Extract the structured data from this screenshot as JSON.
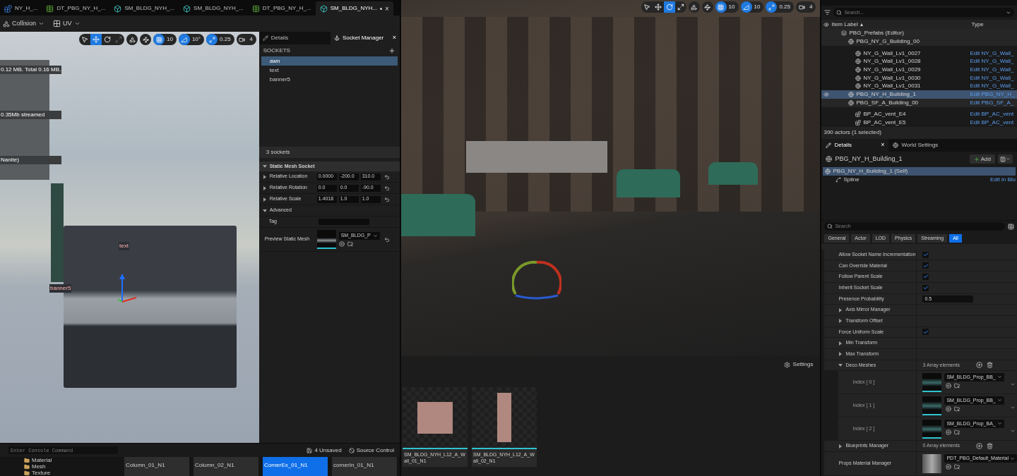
{
  "editor_tabs": [
    {
      "label": "NY_H_...",
      "kind": "blueprint",
      "selected": false
    },
    {
      "label": "DT_PBG_NY_H_...",
      "kind": "datatable",
      "selected": false
    },
    {
      "label": "SM_BLDG_NYH_...",
      "kind": "mesh",
      "selected": false
    },
    {
      "label": "SM_BLDG_NYH_...",
      "kind": "mesh",
      "selected": false
    },
    {
      "label": "DT_PBG_NY_H_...",
      "kind": "datatable",
      "selected": false
    },
    {
      "label": "SM_BLDG_NYH...",
      "kind": "mesh",
      "selected": true,
      "modified": true,
      "close": "×"
    }
  ],
  "mesh_toolbar": [
    {
      "label": "Collision",
      "kind": "collision"
    },
    {
      "label": "UV",
      "kind": "uv"
    }
  ],
  "left_viewport": {
    "stats": [
      "0.12 MB. Total 0.16 MB.",
      "0.35Mb streamed",
      "Nanite)"
    ],
    "socket_labels": [
      "text",
      "banner5"
    ],
    "tools": [
      {
        "kind": "select",
        "selected": false,
        "disabled": false
      },
      {
        "kind": "translate",
        "selected": true,
        "disabled": false
      },
      {
        "kind": "rotate",
        "selected": false,
        "disabled": false
      },
      {
        "kind": "scale",
        "selected": false,
        "disabled": true
      }
    ],
    "snaps": [
      {
        "kind": "grid",
        "value": "10",
        "on": true
      },
      {
        "kind": "angle",
        "value": "10°",
        "on": true
      },
      {
        "kind": "scale",
        "value": "0.25",
        "on": true
      },
      {
        "kind": "camera",
        "value": "4",
        "on": false
      }
    ]
  },
  "socket_panel": {
    "tabs": [
      {
        "label": "Details",
        "kind": "details",
        "selected": false
      },
      {
        "label": "Socket Manager",
        "kind": "sockets",
        "selected": true
      }
    ],
    "close": "×",
    "header": "SOCKETS",
    "sockets": [
      {
        "name": "awn",
        "selected": true
      },
      {
        "name": "text",
        "selected": false
      },
      {
        "name": "banner5",
        "selected": false
      }
    ],
    "count": "3 sockets",
    "section": "Static Mesh Socket",
    "transform_rows": [
      {
        "label": "Relative Location",
        "values": [
          "0.0000",
          "-200.0",
          "310.0"
        ]
      },
      {
        "label": "Relative Rotation",
        "values": [
          "0.0",
          "0.0",
          "-90.0"
        ]
      },
      {
        "label": "Relative Scale",
        "values": [
          "1.4018",
          "1.0",
          "1.0"
        ]
      }
    ],
    "advanced": "Advanced",
    "tag_label": "Tag",
    "preview_label": "Preview Static Mesh",
    "preview_mesh": "SM_BLDG_P"
  },
  "console": {
    "placeholder": "Enter Console Command",
    "unsaved": "4 Unsaved",
    "source_control": "Source Control"
  },
  "folders": [
    "Material",
    "Mesh",
    "Texture"
  ],
  "left_assets": [
    {
      "label": "Column_01_N1",
      "selected": false
    },
    {
      "label": "Column_02_N1",
      "selected": false
    },
    {
      "label": "CornerEx_01_N1",
      "selected": true
    },
    {
      "label": "cornerIn_01_N1",
      "selected": false
    }
  ],
  "main_viewport": {
    "tools": [
      {
        "kind": "select",
        "selected": false,
        "disabled": false
      },
      {
        "kind": "translate",
        "selected": false,
        "disabled": false
      },
      {
        "kind": "rotate",
        "selected": true,
        "disabled": false
      },
      {
        "kind": "scale",
        "selected": false,
        "disabled": false
      }
    ],
    "snaps": [
      {
        "kind": "grid",
        "value": "10",
        "on": true
      },
      {
        "kind": "angle",
        "value": "10",
        "on": true
      },
      {
        "kind": "scale",
        "value": "0.25",
        "on": true
      },
      {
        "kind": "camera",
        "value": "4",
        "on": false
      }
    ]
  },
  "content_browser": {
    "settings": "Settings",
    "assets": [
      {
        "label": "SM_BLDG_NYH_L12_A_Wall_01_N1",
        "kind": "wall"
      },
      {
        "label": "SM_BLDG_NYH_L12_A_Wall_02_N1",
        "kind": "tower"
      }
    ]
  },
  "outliner": {
    "search_placeholder": "Search...",
    "columns": [
      "Item Label",
      "Type"
    ],
    "sort_mark": "▴",
    "rows": [
      {
        "label": "PBG_Prefabs (Editor)",
        "kind": "level",
        "selected": false,
        "children": [
          {
            "label": "PBG_NY_G_Building_00",
            "kind": "actor",
            "selected": false,
            "children": [
              {
                "label": "NY_G_Wall_Lv1_0027",
                "kind": "actor",
                "type": "Edit NY_G_Wall_",
                "selected": false
              },
              {
                "label": "NY_G_Wall_Lv1_0028",
                "kind": "actor",
                "type": "Edit NY_G_Wall_",
                "selected": false
              },
              {
                "label": "NY_G_Wall_Lv1_0029",
                "kind": "actor",
                "type": "Edit NY_G_Wall_",
                "selected": false
              },
              {
                "label": "NY_G_Wall_Lv1_0030",
                "kind": "actor",
                "type": "Edit NY_G_Wall_",
                "selected": false
              },
              {
                "label": "NY_G_Wall_Lv1_0031",
                "kind": "actor",
                "type": "Edit NY_G_Wall_",
                "selected": false
              }
            ]
          },
          {
            "label": "PBG_NY_H_Building_1",
            "kind": "actor",
            "type": "Edit PBG_NY_H_",
            "selected": true
          },
          {
            "label": "PBG_SF_A_Building_00",
            "kind": "actor",
            "type": "Edit PBG_SF_A_",
            "selected": false,
            "children": [
              {
                "label": "BP_AC_vent_E4",
                "kind": "blueprint",
                "type": "Edit BP_AC_vent",
                "selected": false
              },
              {
                "label": "BP_AC_vent_E5",
                "kind": "blueprint",
                "type": "Edit BP_AC_vent",
                "selected": false
              }
            ]
          }
        ]
      }
    ],
    "status": "390 actors (1 selected)"
  },
  "details": {
    "tabs": [
      {
        "label": "Details",
        "kind": "details",
        "selected": true
      },
      {
        "label": "World Settings",
        "kind": "world",
        "selected": false
      }
    ],
    "close": "×",
    "actor": "PBG_NY_H_Building_1",
    "add": "Add",
    "components": [
      {
        "label": "PBG_NY_H_Building_1 (Self)",
        "kind": "actor",
        "selected": true
      },
      {
        "label": "Spline",
        "kind": "spline",
        "selected": false,
        "link": "Edit in Blu"
      }
    ],
    "search_placeholder": "Search",
    "filters": [
      {
        "label": "General",
        "selected": false
      },
      {
        "label": "Actor",
        "selected": false
      },
      {
        "label": "LOD",
        "selected": false
      },
      {
        "label": "Physics",
        "selected": false
      },
      {
        "label": "Streaming",
        "selected": false
      },
      {
        "label": "All",
        "selected": true
      }
    ],
    "properties": [
      {
        "kind": "checkbox",
        "label": "Allow Socket Name Incrementation",
        "checked": true
      },
      {
        "kind": "checkbox",
        "label": "Can Override Material",
        "checked": true
      },
      {
        "kind": "checkbox",
        "label": "Follow Parent Scale",
        "checked": true
      },
      {
        "kind": "checkbox",
        "label": "Inherit Socket Scale",
        "checked": true
      },
      {
        "kind": "number",
        "label": "Presence Probability",
        "value": "0.5"
      },
      {
        "kind": "group",
        "label": "Axis Mirror Manager"
      },
      {
        "kind": "group",
        "label": "Transform Offset"
      },
      {
        "kind": "checkbox",
        "label": "Force Uniform Scale",
        "checked": true
      },
      {
        "kind": "group",
        "label": "Min Transform"
      },
      {
        "kind": "group",
        "label": "Max Transform"
      },
      {
        "kind": "array",
        "label": "Deco Meshes",
        "value": "3 Array elements",
        "expanded": true
      },
      {
        "kind": "mesh",
        "label": "Index [ 0 ]",
        "value": "SM_BLDG_Prop_BB_"
      },
      {
        "kind": "mesh",
        "label": "Index [ 1 ]",
        "value": "SM_BLDG_Prop_BB_"
      },
      {
        "kind": "mesh",
        "label": "Index [ 2 ]",
        "value": "SM_BLDG_Prop_BA_"
      },
      {
        "kind": "array",
        "label": "Blueprints Manager",
        "value": "0 Array elements",
        "expanded": false
      },
      {
        "kind": "material",
        "label": "Props Material Manager",
        "value": "PDT_PBG_Default_Material"
      }
    ]
  }
}
